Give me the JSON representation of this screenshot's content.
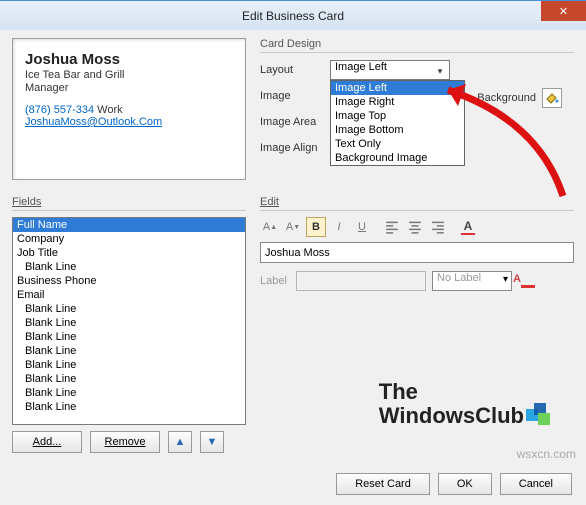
{
  "title": "Edit Business Card",
  "preview": {
    "name": "Joshua Moss",
    "company": "Ice Tea Bar and Grill",
    "title": "Manager",
    "phone": "(876) 557-334",
    "phone_label": "Work",
    "email": "JoshuaMoss@Outlook.Com"
  },
  "design": {
    "section": "Card Design",
    "labels": {
      "layout": "Layout",
      "image": "Image",
      "image_area": "Image Area",
      "image_align": "Image Align"
    },
    "layout_value": "Image Left",
    "layout_options": [
      "Image Left",
      "Image Right",
      "Image Top",
      "Image Bottom",
      "Text Only",
      "Background Image"
    ],
    "background": "Background"
  },
  "fields": {
    "section": "Fields",
    "items": [
      "Full Name",
      "Company",
      "Job Title",
      "Blank Line",
      "Business Phone",
      "Email",
      "Blank Line",
      "Blank Line",
      "Blank Line",
      "Blank Line",
      "Blank Line",
      "Blank Line",
      "Blank Line",
      "Blank Line"
    ],
    "selected": 0,
    "indent": [
      3,
      6,
      7,
      8,
      9,
      10,
      11,
      12,
      13
    ],
    "add": "Add...",
    "remove": "Remove"
  },
  "edit": {
    "section": "Edit",
    "value": "Joshua Moss",
    "label_text": "Label",
    "nolabel": "No Label"
  },
  "bottom": {
    "reset": "Reset Card",
    "ok": "OK",
    "cancel": "Cancel"
  },
  "logo": {
    "line1": "The",
    "line2": "WindowsClub"
  },
  "attrib": "wsxcn.com"
}
